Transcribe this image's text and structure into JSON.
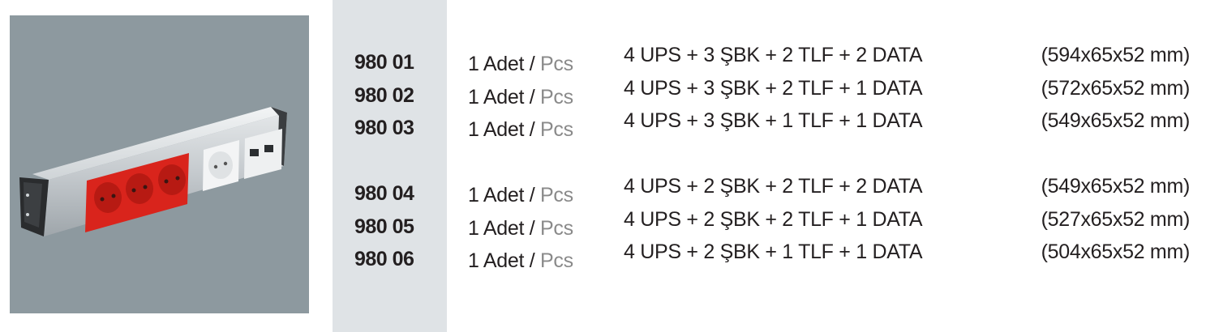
{
  "product_photo": {
    "description_icon": "power-strip-photo",
    "colors": {
      "background": "#8d999f",
      "body": "#c9ced2",
      "sockets": "#d9241c"
    }
  },
  "rows": [
    {
      "code": "980 01",
      "qty": "1 Adet / ",
      "qty_unit": "Pcs",
      "config": "4 UPS + 3 ŞBK + 2 TLF + 2 DATA",
      "dims": "(594x65x52 mm)"
    },
    {
      "code": "980 02",
      "qty": "1 Adet / ",
      "qty_unit": "Pcs",
      "config": "4 UPS + 3 ŞBK + 2 TLF + 1 DATA",
      "dims": "(572x65x52 mm)"
    },
    {
      "code": "980 03",
      "qty": "1 Adet / ",
      "qty_unit": "Pcs",
      "config": "4 UPS + 3 ŞBK + 1 TLF + 1 DATA",
      "dims": "(549x65x52 mm)"
    },
    {
      "code": "980 04",
      "qty": "1 Adet / ",
      "qty_unit": "Pcs",
      "config": "4 UPS + 2 ŞBK + 2 TLF + 2 DATA",
      "dims": "(549x65x52 mm)"
    },
    {
      "code": "980 05",
      "qty": "1 Adet / ",
      "qty_unit": "Pcs",
      "config": "4 UPS + 2 ŞBK + 2 TLF + 1 DATA",
      "dims": "(527x65x52 mm)"
    },
    {
      "code": "980 06",
      "qty": "1 Adet / ",
      "qty_unit": "Pcs",
      "config": "4 UPS + 2 ŞBK + 1 TLF + 1 DATA",
      "dims": "(504x65x52 mm)"
    }
  ]
}
